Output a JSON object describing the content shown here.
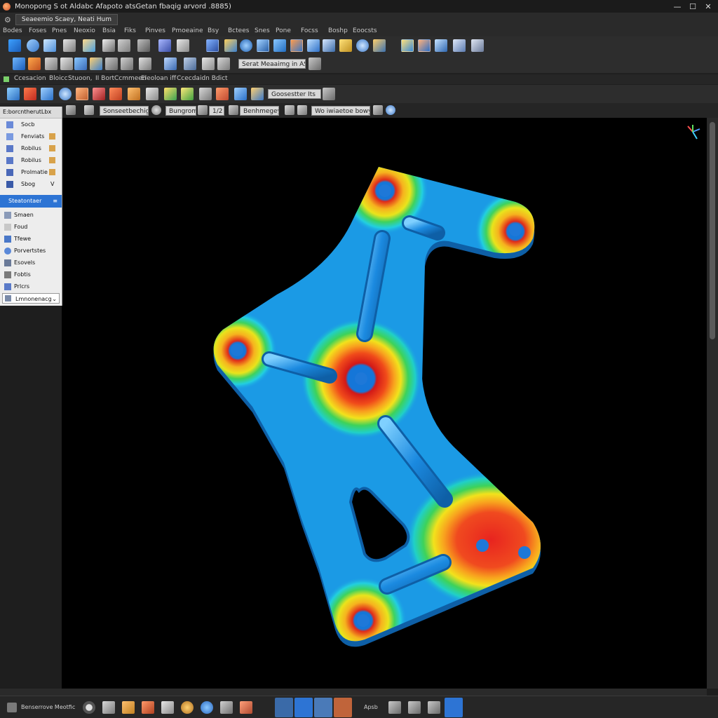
{
  "titlebar": {
    "title": "Monopong S ot Aldabc Afapoto atsGetan fbaqig arvord .8885)",
    "controls": {
      "minimize": "—",
      "maximize": "☐",
      "close": "✕"
    }
  },
  "document_tab": {
    "label": "Seaeemio Scaey, Neati Hum",
    "settings_glyph": "⚙"
  },
  "menu": [
    "Bodes",
    "Foses",
    "Pnes",
    "Neoxio",
    "Bsia",
    "Fiks",
    "Pinves",
    "Pmoeaine",
    "Bsy",
    "Bctees",
    "Snes",
    "Pone",
    "Focss",
    "Boshp",
    "Eoocsts"
  ],
  "toolbar2": {
    "field_label": "Serat Meaaimg in ASO"
  },
  "tabrow": {
    "tabs": [
      "Ccesacion",
      "Bloicc",
      "Stuoon,",
      "II Bort",
      "Ccmmeen",
      "Eleoloan iff",
      "Ccecdaidn Bdict"
    ]
  },
  "toolbar3": {
    "field_label": "Goosestter Its"
  },
  "toolbar4": {
    "panel_field": "E:borcntherutLbx",
    "fields": [
      "Sonseetbechige iio",
      "Bungrome",
      "1/2",
      "Benhmegey iiv",
      "Wo iwiaetoe bowys ae"
    ]
  },
  "panel": {
    "items": [
      {
        "label": "Socb",
        "icon": "sketch-icon"
      },
      {
        "label": "Fenviats",
        "icon": "features-icon"
      },
      {
        "label": "Robilus",
        "icon": "robot-icon"
      },
      {
        "label": "Robilus",
        "icon": "robot-icon"
      },
      {
        "label": "Prolmatie",
        "icon": "prismatic-icon"
      },
      {
        "label": "Sbog",
        "icon": "shape-icon"
      }
    ],
    "stoo_chevron": "V",
    "selected": {
      "label": "Steatontaer",
      "icon": "≡"
    },
    "items2": [
      {
        "label": "Smaen",
        "icon": "screen-icon"
      },
      {
        "label": "Foud",
        "icon": "fold-icon"
      },
      {
        "label": "Tfewe",
        "icon": "pen-icon"
      },
      {
        "label": "Porvertstes",
        "icon": "globe-icon"
      },
      {
        "label": "Esovels",
        "icon": "list-icon"
      },
      {
        "label": "Fobtis",
        "icon": "flag-icon"
      },
      {
        "label": "Prlcrs",
        "icon": "brush-icon"
      }
    ],
    "dropdown": {
      "label": "Lmnonenacg",
      "chevron": "⌄"
    }
  },
  "statusbar": {
    "text": "Benserrove Meotfic",
    "apps_label": "Apsb"
  },
  "colors": {
    "part_base": "#1b9ae5",
    "part_edge": "#0e5fa6",
    "stress_high": "#e8241f",
    "stress_mid": "#f2e21c",
    "stress_low": "#1fc95a",
    "accent": "#2d74d4"
  }
}
